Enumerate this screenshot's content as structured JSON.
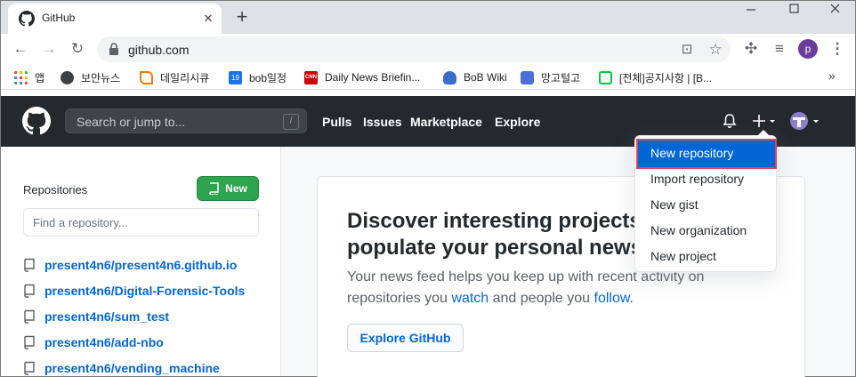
{
  "browser": {
    "tab_title": "GitHub",
    "url": "github.com",
    "profile_initial": "p",
    "bookmarks": [
      {
        "label": "앱",
        "color": "#e8453c"
      },
      {
        "label": "보안뉴스",
        "color": "#3c4043"
      },
      {
        "label": "데일리시큐",
        "color": "#f57c00"
      },
      {
        "label": "bob일정",
        "color": "#1a73e8",
        "badge": "19"
      },
      {
        "label": "Daily News Briefin...",
        "color": "#cc0000",
        "badge": "CNN"
      },
      {
        "label": "BoB Wiki",
        "color": "#3d6dcc"
      },
      {
        "label": "망고털고",
        "color": "#4a6fd8"
      },
      {
        "label": "[전체]공지사항 | [B...",
        "color": "#00c73c"
      }
    ],
    "more_bookmarks": "»"
  },
  "header": {
    "search_placeholder": "Search or jump to...",
    "search_shortcut": "/",
    "nav": [
      "Pulls",
      "Issues",
      "Marketplace",
      "Explore"
    ]
  },
  "sidebar": {
    "title": "Repositories",
    "new_button": "New",
    "find_placeholder": "Find a repository...",
    "repos": [
      "present4n6/present4n6.github.io",
      "present4n6/Digital-Forensic-Tools",
      "present4n6/sum_test",
      "present4n6/add-nbo",
      "present4n6/vending_machine"
    ]
  },
  "main": {
    "discover_title_line1": "Discover interesting projects and",
    "discover_title_line2": "populate your personal news feed.",
    "body_prefix": "Your news feed helps you keep up with recent activity on repositories you ",
    "body_watch": "watch",
    "body_middle": " and people you ",
    "body_follow": "follow",
    "body_suffix": ".",
    "explore_button": "Explore GitHub"
  },
  "dropdown": {
    "items": [
      "New repository",
      "Import repository",
      "New gist",
      "New organization",
      "New project"
    ],
    "selected_index": 0
  },
  "colors": {
    "header_bg": "#24292e",
    "new_button_green": "#2ea44f",
    "link_blue": "#0366d6",
    "highlight_red": "#e0455a"
  }
}
